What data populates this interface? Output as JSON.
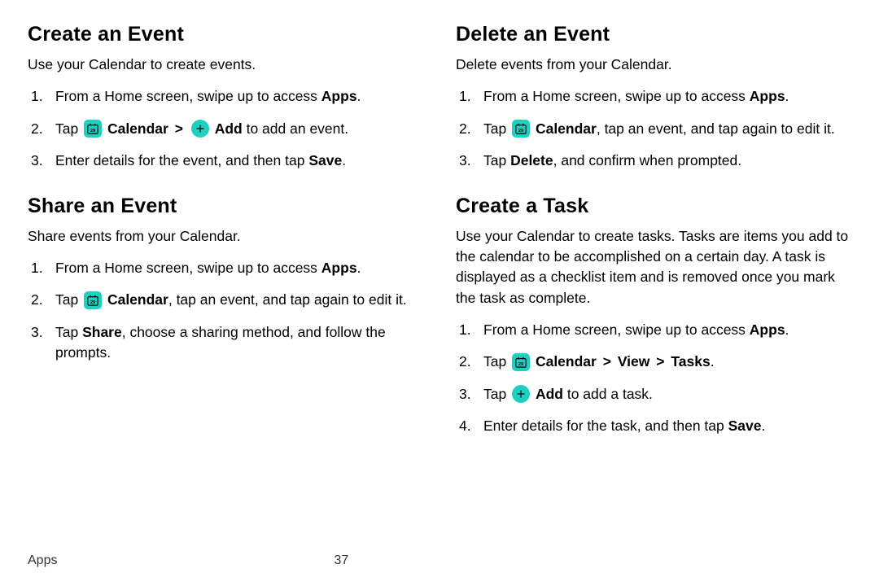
{
  "footer": {
    "section": "Apps",
    "page": "37"
  },
  "chevron": ">",
  "sections": {
    "createEvent": {
      "heading": "Create an Event",
      "intro": "Use your Calendar to create events.",
      "step1_a": "From a Home screen, swipe up to access ",
      "step1_b": "Apps",
      "step1_c": ".",
      "step2_a": "Tap ",
      "step2_cal": "Calendar",
      "step2_add": "Add",
      "step2_b": " to add an event.",
      "step3_a": "Enter details for the event, and then tap ",
      "step3_b": "Save",
      "step3_c": "."
    },
    "shareEvent": {
      "heading": "Share an Event",
      "intro": "Share events from your Calendar.",
      "step1_a": "From a Home screen, swipe up to access ",
      "step1_b": "Apps",
      "step1_c": ".",
      "step2_a": "Tap ",
      "step2_cal": "Calendar",
      "step2_b": ", tap an event, and tap again to edit it.",
      "step3_a": "Tap ",
      "step3_b": "Share",
      "step3_c": ", choose a sharing method, and follow the prompts."
    },
    "deleteEvent": {
      "heading": "Delete an Event",
      "intro": "Delete events from your Calendar.",
      "step1_a": "From a Home screen, swipe up to access ",
      "step1_b": "Apps",
      "step1_c": ".",
      "step2_a": "Tap ",
      "step2_cal": "Calendar",
      "step2_b": ", tap an event, and tap again to edit it.",
      "step3_a": "Tap ",
      "step3_b": "Delete",
      "step3_c": ", and confirm when prompted."
    },
    "createTask": {
      "heading": "Create a Task",
      "intro": "Use your Calendar to create tasks. Tasks are items you add to the calendar to be accomplished on a certain day. A task is displayed as a checklist item and is removed once you mark the task as complete.",
      "step1_a": "From a Home screen, swipe up to access ",
      "step1_b": "Apps",
      "step1_c": ".",
      "step2_a": "Tap ",
      "step2_cal": "Calendar",
      "step2_view": "View",
      "step2_tasks": "Tasks",
      "step2_end": ".",
      "step3_a": "Tap ",
      "step3_add": "Add",
      "step3_b": " to add a task.",
      "step4_a": "Enter details for the task, and then tap ",
      "step4_b": "Save",
      "step4_c": "."
    }
  }
}
